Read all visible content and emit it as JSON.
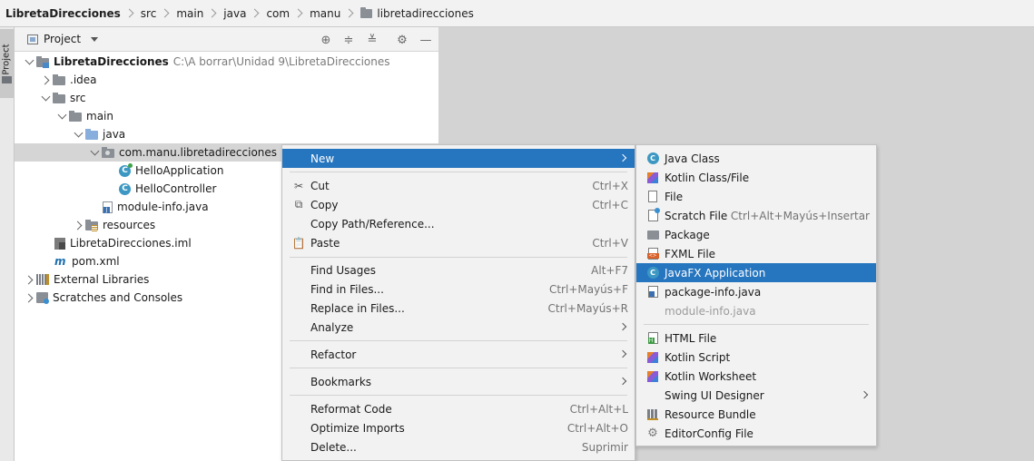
{
  "breadcrumb": {
    "items": [
      "LibretaDirecciones",
      "src",
      "main",
      "java",
      "com",
      "manu",
      "libretadirecciones"
    ]
  },
  "side_stripe": {
    "label": "Project"
  },
  "project_panel": {
    "title": "Project",
    "header_buttons": [
      "locate-icon",
      "expand-all-icon",
      "collapse-all-icon",
      "gear-icon",
      "minimize-icon"
    ],
    "tree": [
      {
        "label": "LibretaDirecciones",
        "path": "C:\\A borrar\\Unidad 9\\LibretaDirecciones",
        "icon": "module-folder-icon",
        "expanded": true
      },
      {
        "label": ".idea",
        "icon": "folder-icon",
        "expanded": false
      },
      {
        "label": "src",
        "icon": "folder-icon",
        "expanded": true
      },
      {
        "label": "main",
        "icon": "folder-icon",
        "expanded": true
      },
      {
        "label": "java",
        "icon": "source-folder-icon",
        "expanded": true
      },
      {
        "label": "com.manu.libretadirecciones",
        "icon": "package-icon",
        "expanded": true,
        "selected": true
      },
      {
        "label": "HelloApplication",
        "icon": "javafx-class-icon"
      },
      {
        "label": "HelloController",
        "icon": "class-icon"
      },
      {
        "label": "module-info.java",
        "icon": "java-file-icon"
      },
      {
        "label": "resources",
        "icon": "resources-folder-icon",
        "expanded": false
      },
      {
        "label": "LibretaDirecciones.iml",
        "icon": "iml-file-icon"
      },
      {
        "label": "pom.xml",
        "icon": "maven-icon"
      },
      {
        "label": "External Libraries",
        "icon": "libraries-icon",
        "expanded": false
      },
      {
        "label": "Scratches and Consoles",
        "icon": "scratches-icon",
        "expanded": false
      }
    ]
  },
  "context_menu": {
    "items": [
      {
        "label": "New",
        "submenu": true,
        "highlighted": true
      },
      {
        "label": "Cut",
        "shortcut": "Ctrl+X",
        "icon": "cut-icon"
      },
      {
        "label": "Copy",
        "shortcut": "Ctrl+C",
        "icon": "copy-icon"
      },
      {
        "label": "Copy Path/Reference...",
        "shortcut": ""
      },
      {
        "label": "Paste",
        "shortcut": "Ctrl+V",
        "icon": "paste-icon"
      },
      {
        "label": "Find Usages",
        "shortcut": "Alt+F7"
      },
      {
        "label": "Find in Files...",
        "shortcut": "Ctrl+Mayús+F"
      },
      {
        "label": "Replace in Files...",
        "shortcut": "Ctrl+Mayús+R"
      },
      {
        "label": "Analyze",
        "submenu": true
      },
      {
        "label": "Refactor",
        "submenu": true
      },
      {
        "label": "Bookmarks",
        "submenu": true
      },
      {
        "label": "Reformat Code",
        "shortcut": "Ctrl+Alt+L"
      },
      {
        "label": "Optimize Imports",
        "shortcut": "Ctrl+Alt+O"
      },
      {
        "label": "Delete...",
        "shortcut": "Suprimir"
      }
    ]
  },
  "new_submenu": {
    "items": [
      {
        "label": "Java Class",
        "icon": "java-class-icon"
      },
      {
        "label": "Kotlin Class/File",
        "icon": "kotlin-icon"
      },
      {
        "label": "File",
        "icon": "file-icon"
      },
      {
        "label": "Scratch File",
        "shortcut": "Ctrl+Alt+Mayús+Insertar",
        "icon": "scratch-file-icon"
      },
      {
        "label": "Package",
        "icon": "package-icon"
      },
      {
        "label": "FXML File",
        "icon": "fxml-file-icon"
      },
      {
        "label": "JavaFX Application",
        "icon": "javafx-class-icon",
        "highlighted": true
      },
      {
        "label": "package-info.java",
        "icon": "java-file-icon"
      },
      {
        "label": "module-info.java",
        "disabled": true
      },
      {
        "label": "HTML File",
        "icon": "html-file-icon"
      },
      {
        "label": "Kotlin Script",
        "icon": "kotlin-script-icon"
      },
      {
        "label": "Kotlin Worksheet",
        "icon": "kotlin-worksheet-icon"
      },
      {
        "label": "Swing UI Designer",
        "submenu": true
      },
      {
        "label": "Resource Bundle",
        "icon": "resource-bundle-icon"
      },
      {
        "label": "EditorConfig File",
        "icon": "gear-icon"
      }
    ]
  },
  "colors": {
    "selection": "#2675bf",
    "tree_selection": "#d5d5d5",
    "menu_bg": "#f2f2f2",
    "class_icon": "#3c98c3"
  }
}
